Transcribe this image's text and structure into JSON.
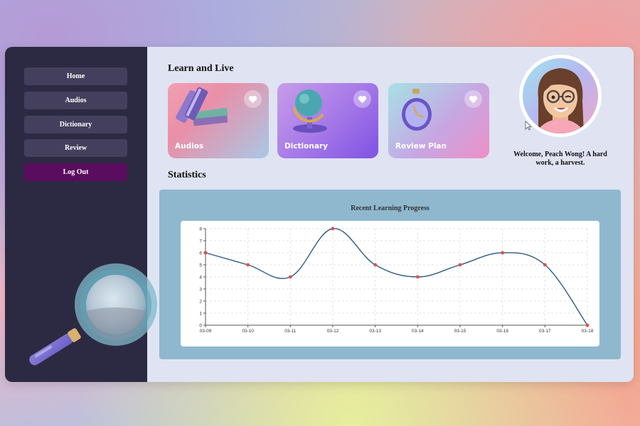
{
  "sidebar": {
    "items": [
      {
        "label": "Home"
      },
      {
        "label": "Audios"
      },
      {
        "label": "Dictionary"
      },
      {
        "label": "Review"
      },
      {
        "label": "Log Out"
      }
    ]
  },
  "main": {
    "section_title": "Learn and Live",
    "statistics_title": "Statistics",
    "cards": [
      {
        "label": "Audios",
        "icon": "books-icon"
      },
      {
        "label": "Dictionary",
        "icon": "globe-icon"
      },
      {
        "label": "Review Plan",
        "icon": "clock-icon"
      }
    ]
  },
  "user": {
    "welcome": "Welcome, Peach Wong! A hard work, a harvest."
  },
  "colors": {
    "sidebar_bg": "#2c2a42",
    "nav_button": "#453f5e",
    "logout_button": "#5a0c5e",
    "content_bg": "#dfe3f2",
    "chart_panel": "#8fb8cf",
    "line": "#2e5a85",
    "point": "#d9534f"
  },
  "chart_data": {
    "type": "line",
    "title": "Recent Learning Progress",
    "xlabel": "",
    "ylabel": "",
    "categories": [
      "03-09",
      "03-10",
      "03-11",
      "03-12",
      "03-13",
      "03-14",
      "03-15",
      "03-16",
      "03-17",
      "03-18"
    ],
    "values": [
      6,
      5,
      4,
      8,
      5,
      4,
      5,
      6,
      5,
      0
    ],
    "ylim": [
      0,
      8
    ],
    "yticks": [
      0,
      1,
      2,
      3,
      4,
      5,
      6,
      7,
      8
    ],
    "smooth": true,
    "grid": true
  }
}
